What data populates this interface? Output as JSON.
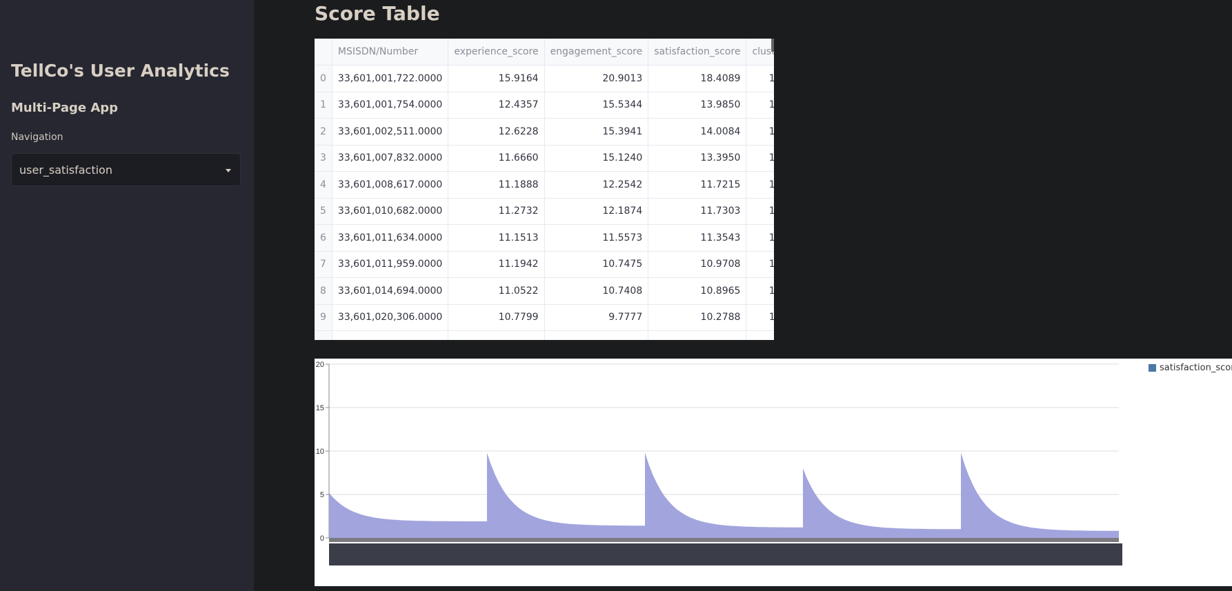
{
  "sidebar": {
    "app_title": "TellCo's User Analytics",
    "subtitle": "Multi-Page App",
    "nav_label": "Navigation",
    "nav_selected": "user_satisfaction"
  },
  "main": {
    "heading": "Score Table"
  },
  "table": {
    "columns": [
      "",
      "MSISDN/Number",
      "experience_score",
      "engagement_score",
      "satisfaction_score",
      "clust"
    ],
    "rows": [
      [
        "0",
        "33,601,001,722.0000",
        "15.9164",
        "20.9013",
        "18.4089",
        "1"
      ],
      [
        "1",
        "33,601,001,754.0000",
        "12.4357",
        "15.5344",
        "13.9850",
        "1"
      ],
      [
        "2",
        "33,601,002,511.0000",
        "12.6228",
        "15.3941",
        "14.0084",
        "1"
      ],
      [
        "3",
        "33,601,007,832.0000",
        "11.6660",
        "15.1240",
        "13.3950",
        "1"
      ],
      [
        "4",
        "33,601,008,617.0000",
        "11.1888",
        "12.2542",
        "11.7215",
        "1"
      ],
      [
        "5",
        "33,601,010,682.0000",
        "11.2732",
        "12.1874",
        "11.7303",
        "1"
      ],
      [
        "6",
        "33,601,011,634.0000",
        "11.1513",
        "11.5573",
        "11.3543",
        "1"
      ],
      [
        "7",
        "33,601,011,959.0000",
        "11.1942",
        "10.7475",
        "10.9708",
        "1"
      ],
      [
        "8",
        "33,601,014,694.0000",
        "11.0522",
        "10.7408",
        "10.8965",
        "1"
      ],
      [
        "9",
        "33,601,020,306.0000",
        "10.7799",
        "9.7777",
        "10.2788",
        "1"
      ]
    ]
  },
  "chart_data": {
    "type": "area",
    "title": "",
    "xlabel": "",
    "ylabel": "",
    "ylim": [
      0,
      20
    ],
    "yticks": [
      "0",
      "5",
      "10",
      "15",
      "20"
    ],
    "grid": true,
    "legend_position": "top-right",
    "series": [
      {
        "name": "satisfaction_score",
        "color": "#4c78a8",
        "fill_color": "#9d9fdc",
        "segments": [
          {
            "start": 5.2,
            "end": 1.9
          },
          {
            "start": 9.8,
            "end": 1.4
          },
          {
            "start": 9.8,
            "end": 1.2
          },
          {
            "start": 8.0,
            "end": 1.0
          },
          {
            "start": 9.8,
            "end": 0.8
          }
        ]
      }
    ]
  }
}
